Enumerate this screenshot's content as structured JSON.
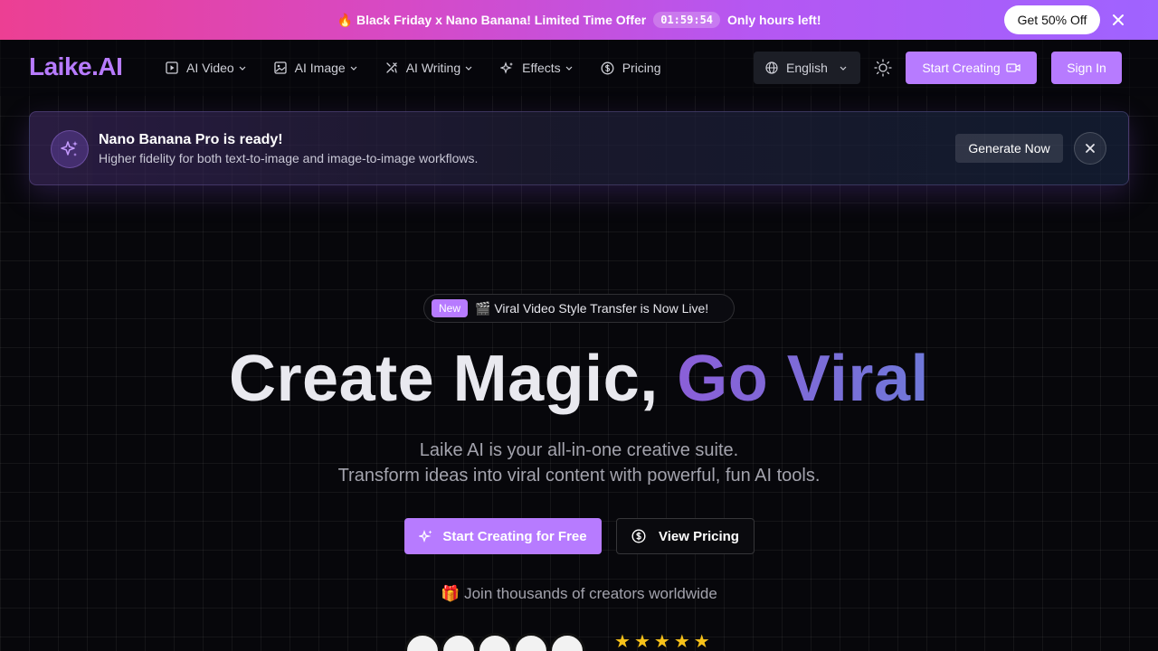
{
  "promo": {
    "fire": "🔥",
    "text": "Black Friday x Nano Banana! Limited Time Offer",
    "timer": "01:59:54",
    "tail": "Only hours left!",
    "cta": "Get 50% Off"
  },
  "nav": {
    "logo": "Laike.AI",
    "items": [
      {
        "label": "AI Video",
        "icon": "video-icon"
      },
      {
        "label": "AI Image",
        "icon": "image-icon"
      },
      {
        "label": "AI Writing",
        "icon": "writing-icon"
      },
      {
        "label": "Effects",
        "icon": "sparkles-icon"
      },
      {
        "label": "Pricing",
        "icon": "dollar-icon"
      }
    ],
    "language": "English",
    "start_creating": "Start Creating",
    "sign_in": "Sign In"
  },
  "announcement": {
    "title": "Nano Banana Pro is ready!",
    "subtitle": "Higher fidelity for both text-to-image and image-to-image workflows.",
    "button": "Generate Now"
  },
  "hero": {
    "badge": "New",
    "badge_text": "🎬 Viral Video Style Transfer is Now Live!",
    "headline_plain": "Create Magic, ",
    "headline_accent": "Go Viral",
    "sub1": "Laike AI is your all-in-one creative suite.",
    "sub2": "Transform ideas into viral content with powerful, fun AI tools.",
    "primary_cta": "Start Creating for Free",
    "secondary_cta": "View Pricing",
    "join": "🎁 Join thousands of creators worldwide",
    "rating_stars": 5
  },
  "colors": {
    "accent": "#b77bff",
    "background": "#07070b",
    "star": "#f7c21a"
  }
}
